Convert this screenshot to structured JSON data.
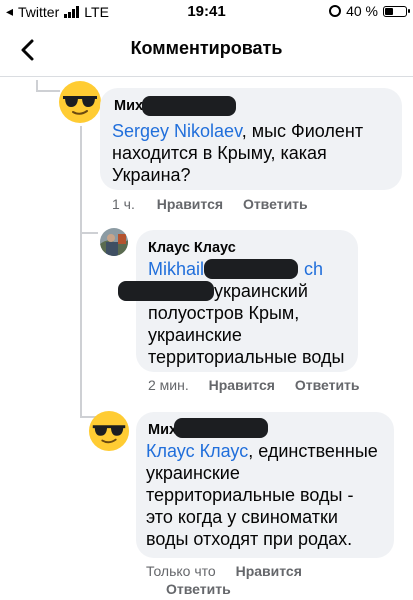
{
  "status_bar": {
    "carrier": "Twitter",
    "network": "LTE",
    "time": "19:41",
    "battery": "40 %"
  },
  "header": {
    "title": "Комментировать"
  },
  "comments": [
    {
      "author_visible": "Мих",
      "mention": "Sergey Nikolaev",
      "lines": [
        ", мыс Фиолент",
        "находится в Крыму, какая",
        "Украина?"
      ],
      "time": "1 ч.",
      "like": "Нравится",
      "reply": "Ответить"
    },
    {
      "author": "Клаус Клаус",
      "mention_start": "Mikhail",
      "mention_end": "ch",
      "lines": [
        "украинский",
        "полуостров Крым,",
        "украинские",
        "территориальные воды"
      ],
      "time": "2 мин.",
      "like": "Нравится",
      "reply": "Ответить"
    },
    {
      "author_visible": "Мих",
      "mention": "Клаус Клаус",
      "lines": [
        ", единственные",
        "украинские",
        "территориальные воды -",
        "это когда у свиноматки",
        "воды отходят при родах."
      ],
      "time": "Только что",
      "like": "Нравится",
      "reply": "Ответить"
    }
  ],
  "icons": {
    "back": "chevron-left-icon",
    "emoji_avatar": "sunglasses-face-icon",
    "photo_avatar": "profile-photo",
    "signal": "signal-bars-icon",
    "alarm": "alarm-icon",
    "battery": "battery-icon"
  }
}
